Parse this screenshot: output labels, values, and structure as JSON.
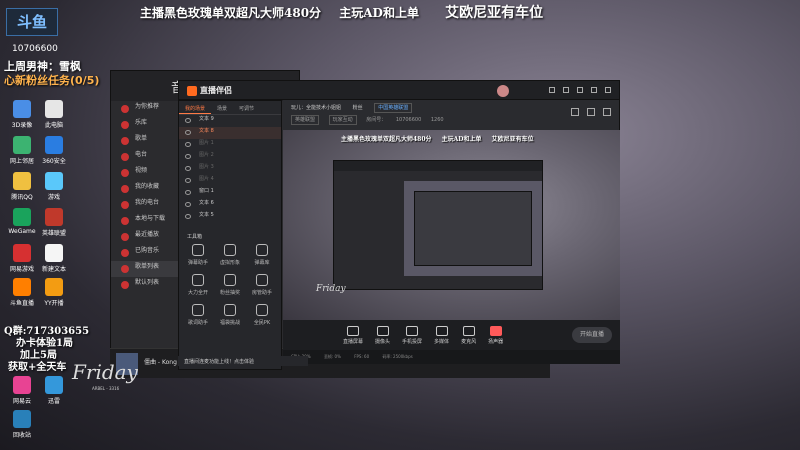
{
  "top_banner": {
    "line": "主播黑色玫瑰单双超凡大师480分",
    "role": "主玩AD和上单",
    "car": "艾欧尼亚有车位"
  },
  "logo": "斗鱼",
  "room_number": "10706600",
  "weekly_best": "上周男神：雪枫",
  "new_fan_task": "心新粉丝任务(0/5)",
  "side_info": {
    "qq": "Q群:717303655",
    "line2": "办卡体验1局",
    "line3": "加上5局",
    "line4": "获取+全天车"
  },
  "desktop_icons": [
    {
      "label": "3D录像"
    },
    {
      "label": "此电脑"
    },
    {
      "label": "网上邻居"
    },
    {
      "label": "360安全"
    },
    {
      "label": "腾讯QQ"
    },
    {
      "label": "游戏"
    },
    {
      "label": "WeGame"
    },
    {
      "label": "英雄联盟"
    },
    {
      "label": "网易游戏"
    },
    {
      "label": "新建文本"
    },
    {
      "label": "斗鱼直播"
    },
    {
      "label": "YY开播"
    },
    {
      "label": "网易云"
    },
    {
      "label": "迅雷"
    },
    {
      "label": "回收站"
    }
  ],
  "music_app": {
    "title": "音乐",
    "nav": [
      "为你推荐",
      "乐库",
      "歌单",
      "电台",
      "视频",
      "我的收藏",
      "我的电台",
      "本地与下载",
      "最近播放",
      "已购音乐",
      "歌单列表",
      "默认列表"
    ],
    "now_playing": "僵曲 - Kong"
  },
  "app": {
    "name": "直播伴侣",
    "room_title": "玩儿：全能技术小姐姐",
    "category": "中国英雄联盟",
    "fans_label": "粉丝",
    "id_label": "房间号：",
    "id_value": "10706600",
    "hot": "1260",
    "chips": [
      "英雄联盟",
      "玩家互动"
    ],
    "scene_tabs": [
      "我的场景",
      "场景",
      "可调节"
    ],
    "sources": [
      {
        "label": "文本 9",
        "state": "normal"
      },
      {
        "label": "文本 8",
        "state": "sel"
      },
      {
        "label": "图片 1",
        "state": "dim"
      },
      {
        "label": "图片 2",
        "state": "dim"
      },
      {
        "label": "图片 3",
        "state": "dim"
      },
      {
        "label": "图片 4",
        "state": "dim"
      },
      {
        "label": "窗口 1",
        "state": "normal"
      },
      {
        "label": "文本 6",
        "state": "normal"
      },
      {
        "label": "文本 5",
        "state": "normal"
      }
    ],
    "tools_label": "工具箱",
    "tools": [
      "弹幕助手",
      "虚拟形象",
      "弹幕库",
      "大力全开",
      "粉丝抽奖",
      "房管助手",
      "歌词助手",
      "福袋挑战",
      "全民PK"
    ],
    "bottom_tools": [
      "直播屏幕",
      "摄像头",
      "手机投屏",
      "多媒体",
      "麦克风",
      "扬声器"
    ],
    "start_label": "开始直播",
    "status": [
      "CPU: 29%",
      "丢帧: 0%",
      "FPS: 60",
      "码率: 2500kbps"
    ],
    "notice": "直播间连麦功能上线！点击体验"
  },
  "preview_banner": {
    "line": "主播黑色玫瑰单双超凡大师480分",
    "role": "主玩AD和上单",
    "car": "艾欧尼亚有车位"
  },
  "friday": "Friday",
  "friday_sub": "ARBEL - 3316"
}
